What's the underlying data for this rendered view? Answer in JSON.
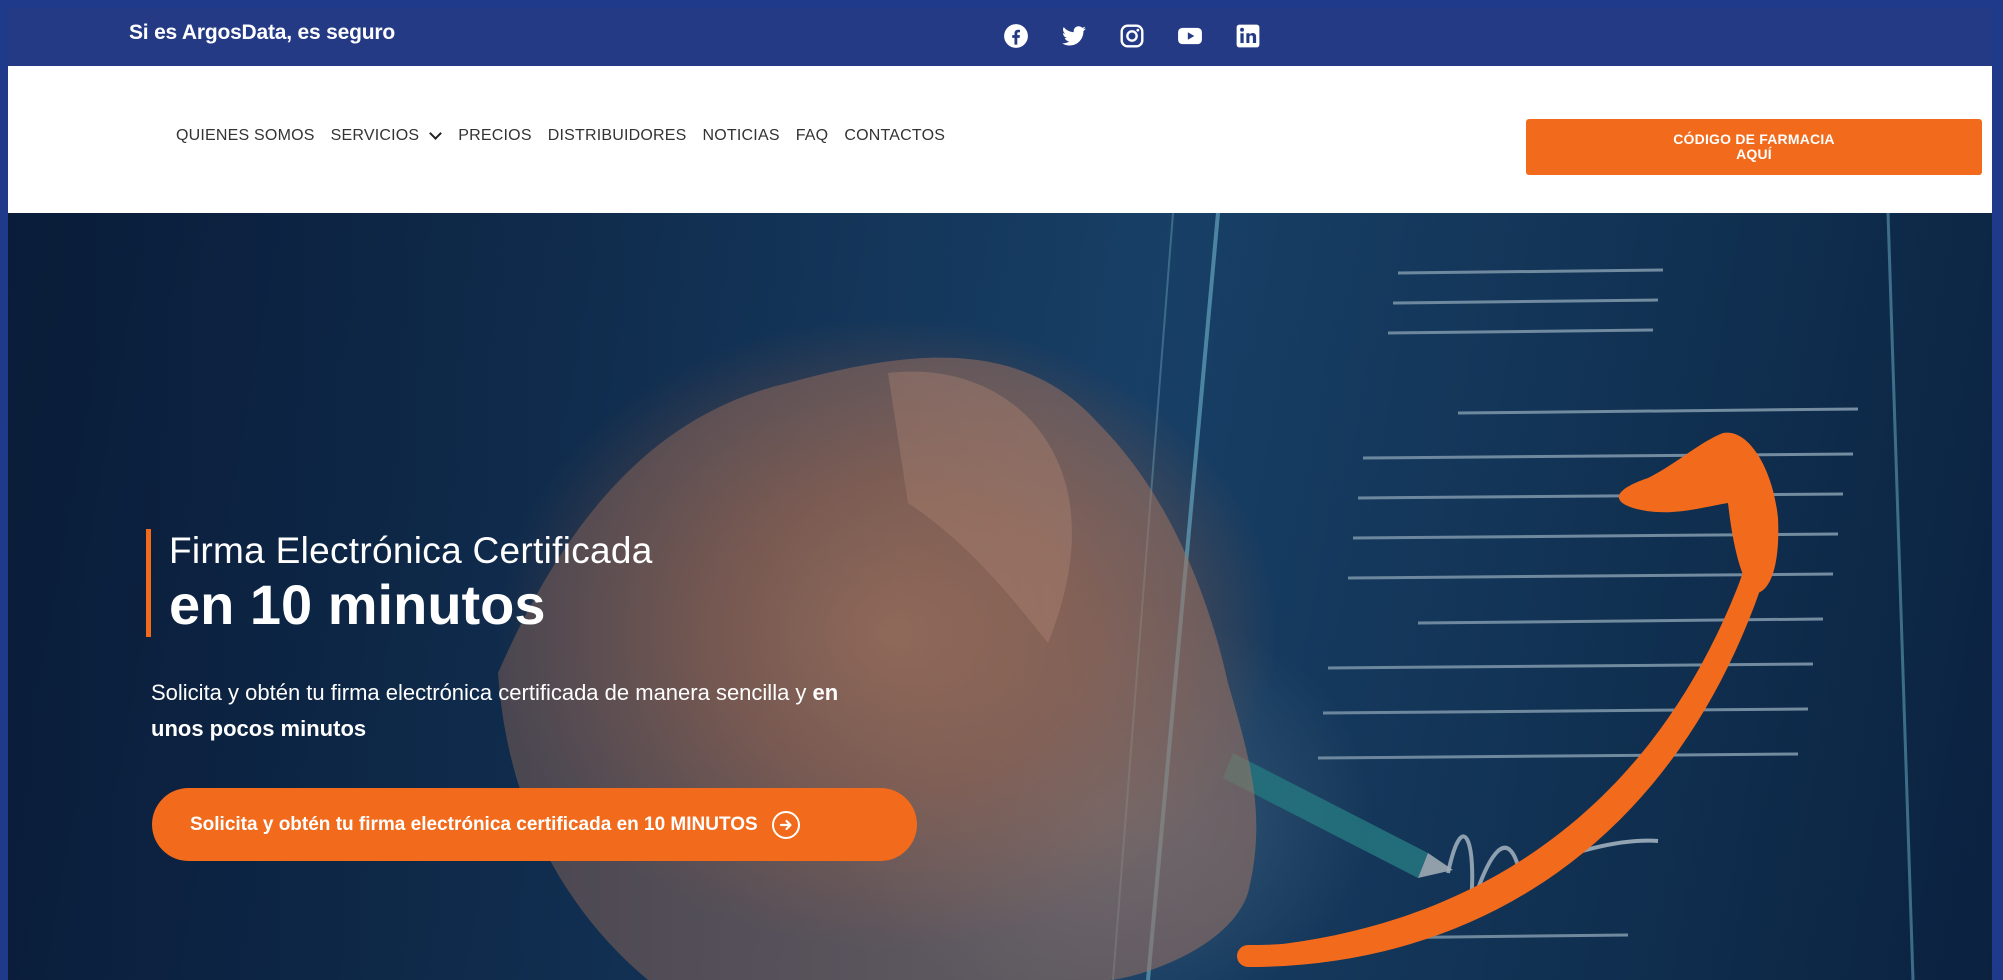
{
  "topbar": {
    "tagline": "Si es ArgosData, es seguro",
    "social_icons": [
      "facebook-icon",
      "twitter-icon",
      "instagram-icon",
      "youtube-icon",
      "linkedin-icon"
    ]
  },
  "nav": {
    "items": [
      {
        "label": "QUIENES SOMOS"
      },
      {
        "label": "SERVICIOS",
        "has_dropdown": true
      },
      {
        "label": "PRECIOS"
      },
      {
        "label": "DISTRIBUIDORES"
      },
      {
        "label": "NOTICIAS"
      },
      {
        "label": "FAQ"
      },
      {
        "label": "CONTACTOS"
      }
    ],
    "cta": {
      "line1": "CÓDIGO DE FARMACIA",
      "line2": "AQUÍ"
    }
  },
  "hero": {
    "title_line1": "Firma Electrónica Certificada",
    "title_line2": "en 10 minutos",
    "description_part1": "Solicita y obtén tu firma electrónica certificada de manera sencilla y ",
    "description_bold": "en unos pocos minutos",
    "cta_label": "Solicita y obtén tu firma electrónica certificada en 10 MINUTOS"
  },
  "colors": {
    "accent": "#f26a1b",
    "topbar": "#243a85",
    "frame": "#1f3a8a"
  }
}
